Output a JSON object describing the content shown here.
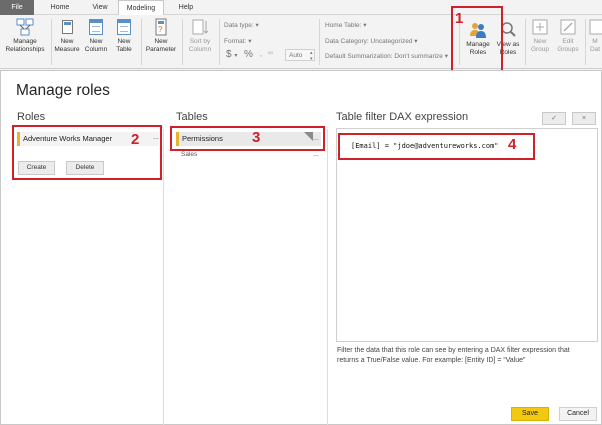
{
  "tabs": {
    "file": "File",
    "home": "Home",
    "view": "View",
    "modeling": "Modeling",
    "help": "Help"
  },
  "ribbon": {
    "manage_relationships": "Manage\nRelationships",
    "new_measure": "New\nMeasure",
    "new_column": "New\nColumn",
    "new_table": "New\nTable",
    "new_parameter": "New\nParameter",
    "sort_by_column": "Sort by\nColumn",
    "data_type": "Data type:",
    "format": "Format:",
    "auto": "Auto",
    "home_table": "Home Table:",
    "data_category": "Data Category: Uncategorized",
    "default_summarization": "Default Summarization: Don't summarize",
    "manage_roles": "Manage\nRoles",
    "view_as_roles": "View as\nRoles",
    "new_group": "New\nGroup",
    "edit_groups": "Edit\nGroups",
    "mark_as_date_table_partial": "M\nDat"
  },
  "callouts": {
    "one": "1",
    "two": "2",
    "three": "3",
    "four": "4"
  },
  "dialog": {
    "title": "Manage roles",
    "roles_header": "Roles",
    "tables_header": "Tables",
    "dax_header": "Table filter DAX expression",
    "role_name": "Adventure Works Manager",
    "role_more": "...",
    "create_label": "Create",
    "delete_label": "Delete",
    "tables": [
      {
        "name": "Permissions",
        "more": "..."
      },
      {
        "name": "Sales",
        "more": "..."
      }
    ],
    "dax_expression": "[Email] = \"jdoe@adventureworks.com\"",
    "check_label": "✓",
    "close_label": "×",
    "help_text": "Filter the data that this role can see by entering a DAX filter expression that returns a True/False value. For example: [Entity ID] = “Value”",
    "save_label": "Save",
    "cancel_label": "Cancel"
  },
  "colors": {
    "accent_yellow": "#f2c811",
    "callout_red": "#d0202a",
    "selection_bar": "#e9b32d"
  }
}
